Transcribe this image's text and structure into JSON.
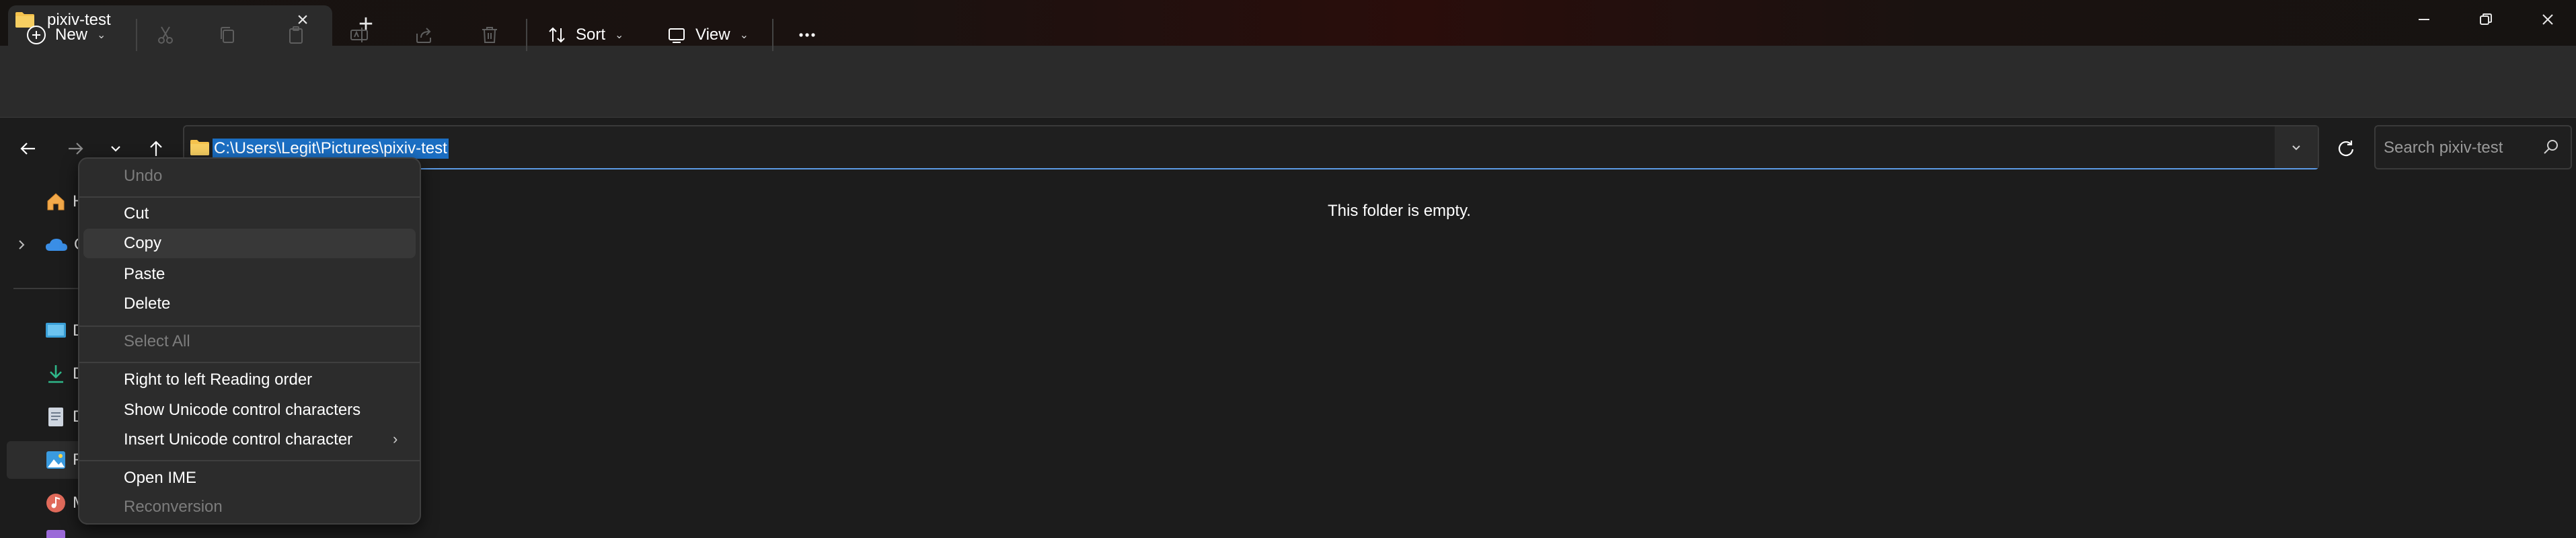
{
  "tab": {
    "title": "pixiv-test"
  },
  "toolbar": {
    "new_label": "New",
    "sort_label": "Sort",
    "view_label": "View"
  },
  "address_bar": {
    "path": "C:\\Users\\Legit\\Pictures\\pixiv-test"
  },
  "search": {
    "placeholder": "Search pixiv-test"
  },
  "sidebar": {
    "items": [
      {
        "label": "H",
        "icon": "home-icon"
      },
      {
        "label": "O",
        "icon": "onedrive-icon"
      },
      {
        "label": "D",
        "icon": "desktop-icon"
      },
      {
        "label": "D",
        "icon": "downloads-icon"
      },
      {
        "label": "D",
        "icon": "documents-icon"
      },
      {
        "label": "P",
        "icon": "pictures-icon"
      },
      {
        "label": "M",
        "icon": "music-icon"
      }
    ]
  },
  "main": {
    "empty_message": "This folder is empty."
  },
  "context_menu": {
    "undo": "Undo",
    "cut": "Cut",
    "copy": "Copy",
    "paste": "Paste",
    "delete": "Delete",
    "select_all": "Select All",
    "rtl": "Right to left Reading order",
    "show_unicode": "Show Unicode control characters",
    "insert_unicode": "Insert Unicode control character",
    "open_ime": "Open IME",
    "reconversion": "Reconversion"
  },
  "colors": {
    "selection": "#1b6ec2",
    "folder": "#f4c24d",
    "accent_underline": "#5c9be6"
  }
}
